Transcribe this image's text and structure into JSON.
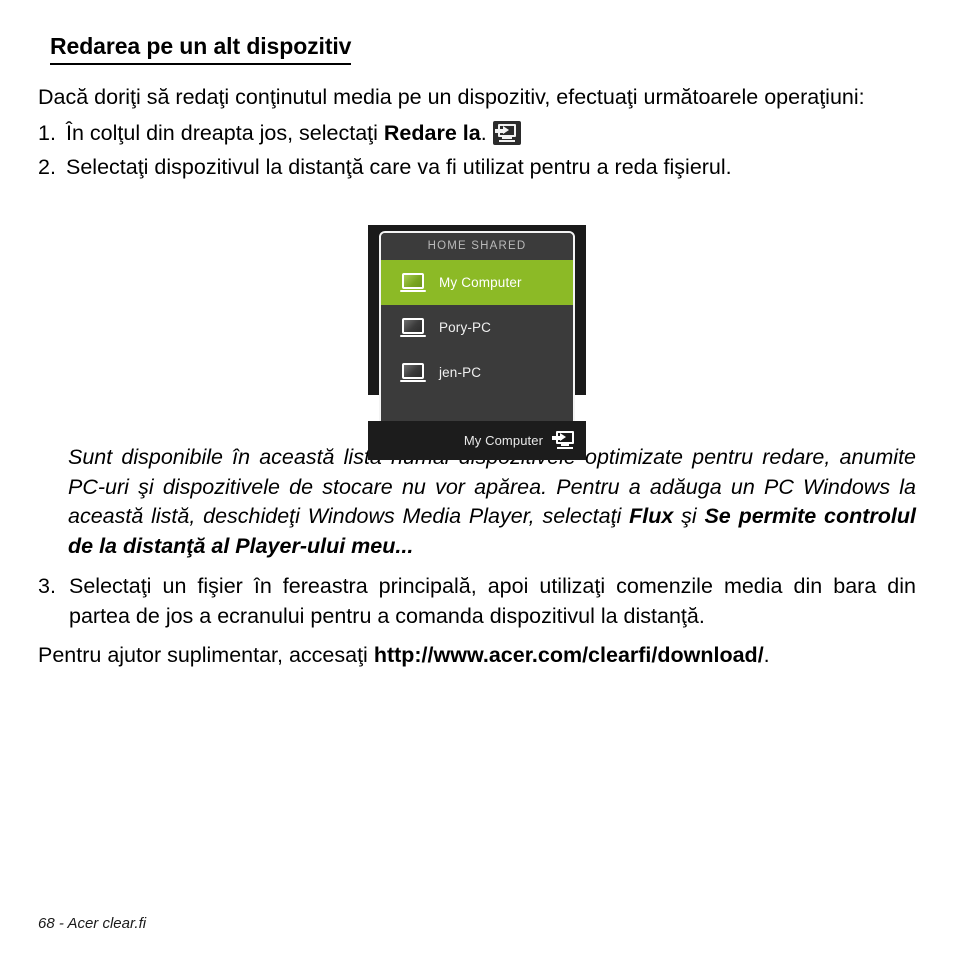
{
  "heading": "Redarea pe un alt dispozitiv",
  "intro": {
    "text": "Dacă doriţi să redaţi conţinutul media pe un dispozitiv, efectuaţi următoarele operaţiuni:"
  },
  "steps": [
    {
      "num": "1.",
      "text_before": "În colţul din dreapta jos, selectaţi ",
      "bold": "Redare la",
      "text_after": ".",
      "icon": "play-to-icon"
    },
    {
      "num": "2.",
      "text_before": "Selectaţi dispozitivul la distanţă care va fi utilizat pentru a reda fişierul.",
      "bold": "",
      "text_after": ""
    },
    {
      "num": "3.",
      "text_before": "Selectaţi un fişier în fereastra principală, apoi utilizaţi comenzile media din bara din partea de jos a ecranului pentru a comanda dispozitivul la distanţă.",
      "bold": "",
      "text_after": ""
    }
  ],
  "note": {
    "part1": "Sunt disponibile în această listă numai dispozitivele optimizate pentru redare, anumite PC-uri şi dispozitivele de stocare nu vor apărea. Pentru a adăuga un PC Windows la această listă, deschideţi Windows Media Player, selectaţi ",
    "bold1": "Flux",
    "part2": " şi ",
    "bold2": "Se permite controlul de la distanţă al Player-ului meu..."
  },
  "closing": {
    "part1": "Pentru ajutor suplimentar, accesaţi ",
    "url": "http://www.acer.com/clearfi/download/",
    "part2": "."
  },
  "figure": {
    "popup_header": "HOME SHARED",
    "devices": [
      {
        "label": "My Computer",
        "selected": true,
        "icon": "laptop-icon"
      },
      {
        "label": "Pory-PC",
        "selected": false,
        "icon": "laptop-icon"
      },
      {
        "label": "jen-PC",
        "selected": false,
        "icon": "laptop-icon"
      }
    ],
    "bottom_bar": {
      "label": "My Computer",
      "icon": "play-to-icon"
    },
    "colors": {
      "selected_green": "#8cba26",
      "panel_gray": "#3b3b3b",
      "frame_dark": "#1a1a1a",
      "bar_dark": "#1c1c1c",
      "border_light": "#f4f4f4"
    }
  },
  "footer": "68 - Acer clear.fi"
}
